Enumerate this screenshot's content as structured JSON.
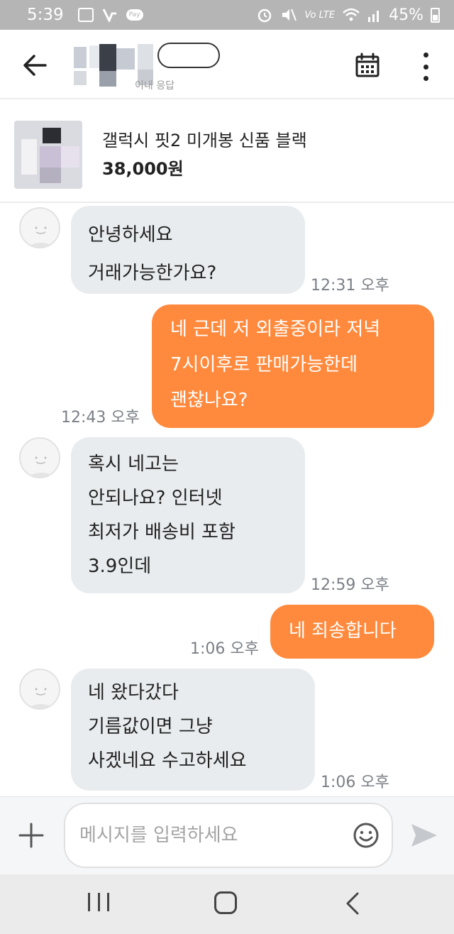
{
  "status_bar": {
    "time": "5:39",
    "pay_label": "Pay",
    "volte_label": "Vo LTE",
    "battery": "45%"
  },
  "header": {
    "back_icon": "arrow-left-icon",
    "title_subtext": "이내 응답",
    "calendar_icon": "calendar-icon",
    "more_icon": "more-vertical-icon"
  },
  "product": {
    "name": "갤럭시 핏2 미개봉 신품 블랙",
    "price": "38,000원"
  },
  "messages": [
    {
      "direction": "in",
      "lines": [
        "안녕하세요",
        "거래가능한가요?"
      ],
      "time": "12:31 오후"
    },
    {
      "direction": "out",
      "lines": [
        "네 근데 저 외출중이라 저녁",
        "7시이후로 판매가능한데",
        "괜찮나요?"
      ],
      "time": "12:43 오후"
    },
    {
      "direction": "in",
      "lines": [
        "혹시 네고는",
        "안되나요? 인터넷",
        "최저가 배송비 포함",
        "3.9인데"
      ],
      "time": "12:59 오후"
    },
    {
      "direction": "out",
      "lines": [
        "네 죄송합니다"
      ],
      "time": "1:06 오후"
    },
    {
      "direction": "in",
      "lines": [
        "네 왔다갔다",
        "기름값이면 그냥",
        "사겠네요 수고하세요"
      ],
      "time": "1:06 오후"
    }
  ],
  "input": {
    "placeholder": "메시지를 입력하세요",
    "value": ""
  },
  "colors": {
    "outgoing_bubble": "#ff8a3d",
    "incoming_bubble": "#e9ecef",
    "timestamp": "#7b7f86"
  }
}
